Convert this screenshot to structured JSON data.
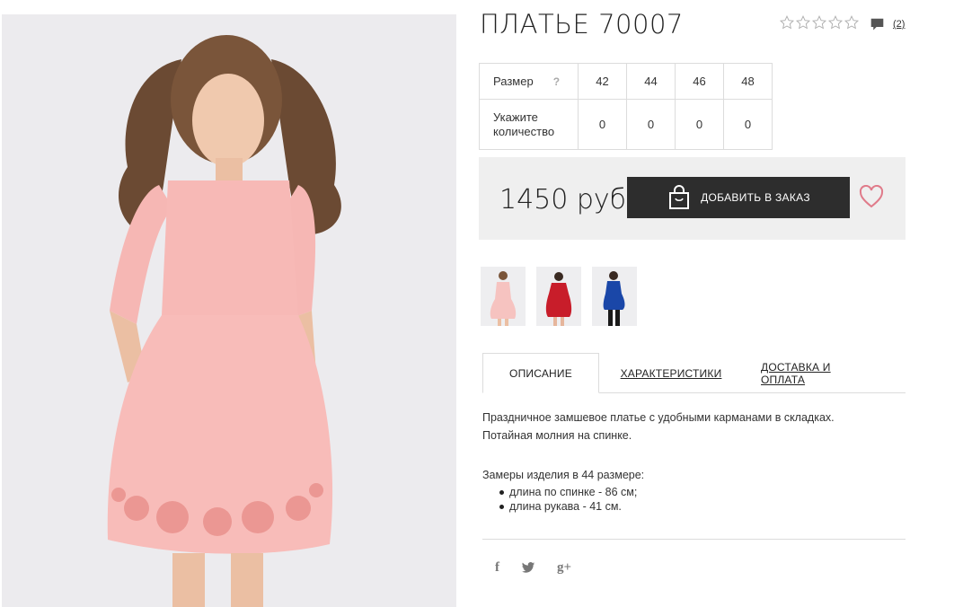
{
  "product": {
    "title": "ПЛАТЬЕ 70007",
    "review_count": "(2)",
    "price": "1450 руб",
    "order_button_label": "ДОБАВИТЬ В ЗАКАЗ"
  },
  "size_table": {
    "size_label": "Размер",
    "help_mark": "?",
    "sizes": [
      "42",
      "44",
      "46",
      "48"
    ],
    "quantity_label": "Укажите количество",
    "quantities": [
      "0",
      "0",
      "0",
      "0"
    ]
  },
  "tabs": [
    {
      "label": "ОПИСАНИЕ"
    },
    {
      "label": "ХАРАКТЕРИСТИКИ"
    },
    {
      "label": "ДОСТАВКА И ОПЛАТА"
    }
  ],
  "description": {
    "line1": "Праздничное замшевое платье с удобными карманами в складках.",
    "line2": "Потайная молния на спинке.",
    "measure_title": "Замеры изделия в 44 размере:",
    "measures": [
      "длина по спинке - 86 см;",
      "длина рукава - 41 см."
    ]
  },
  "social": {
    "facebook": "f",
    "google": "g+"
  },
  "colors": {
    "dark_button": "#2d2d2d",
    "heart": "#e07b8a",
    "price_bg": "#efefef",
    "dress_pink": "#f6b7b4"
  },
  "icons": [
    "star-outline-icon",
    "comment-icon",
    "shopping-bag-icon",
    "heart-icon",
    "facebook-icon",
    "twitter-icon",
    "google-plus-icon"
  ]
}
